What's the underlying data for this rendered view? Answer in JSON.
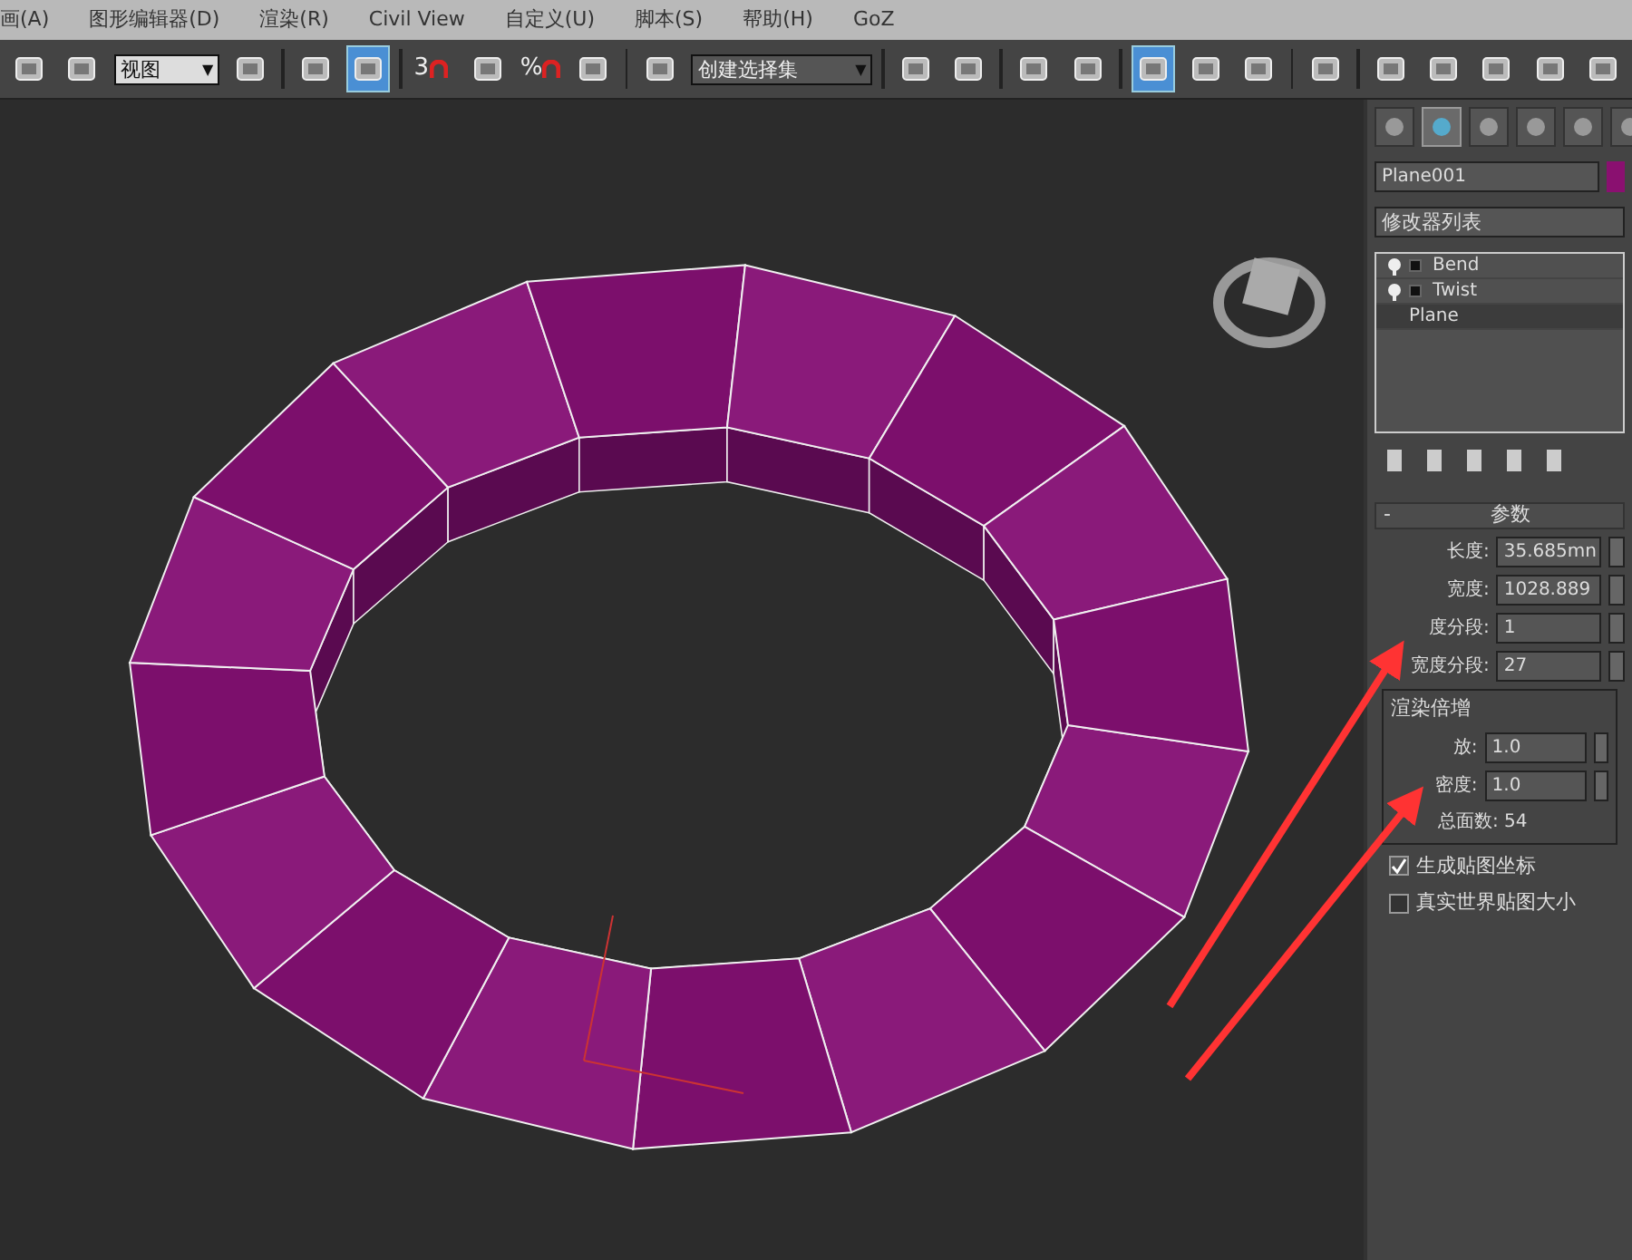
{
  "menu": [
    "画(A)",
    "图形编辑器(D)",
    "渲染(R)",
    "Civil View",
    "自定义(U)",
    "脚本(S)",
    "帮助(H)",
    "GoZ"
  ],
  "toolbar": [
    {
      "kind": "button",
      "selected": false
    },
    {
      "kind": "button",
      "selected": false
    },
    {
      "kind": "dropdown",
      "value": "视图",
      "caret": "▼"
    },
    {
      "kind": "button",
      "selected": false
    },
    {
      "kind": "sep"
    },
    {
      "kind": "button",
      "selected": false
    },
    {
      "kind": "button",
      "selected": true
    },
    {
      "kind": "sep"
    },
    {
      "kind": "snap",
      "glyph": "3",
      "selected": false
    },
    {
      "kind": "button",
      "selected": false
    },
    {
      "kind": "snap",
      "glyph": "%",
      "selected": false
    },
    {
      "kind": "button",
      "selected": false
    },
    {
      "kind": "sep"
    },
    {
      "kind": "button",
      "selected": false
    },
    {
      "kind": "dropdown",
      "value": "创建选择集",
      "caret": "▼"
    },
    {
      "kind": "sep"
    },
    {
      "kind": "button",
      "selected": false
    },
    {
      "kind": "button",
      "selected": false
    },
    {
      "kind": "sep"
    },
    {
      "kind": "button",
      "selected": false
    },
    {
      "kind": "button",
      "selected": false
    },
    {
      "kind": "sep"
    },
    {
      "kind": "button",
      "selected": true
    },
    {
      "kind": "button",
      "selected": false
    },
    {
      "kind": "button",
      "selected": false
    },
    {
      "kind": "sep"
    },
    {
      "kind": "button",
      "selected": false
    },
    {
      "kind": "sep"
    },
    {
      "kind": "button",
      "selected": false
    },
    {
      "kind": "button",
      "selected": false
    },
    {
      "kind": "button",
      "selected": false
    },
    {
      "kind": "button",
      "selected": false
    },
    {
      "kind": "button",
      "selected": false
    }
  ],
  "command_tabs": [
    {
      "selected": false
    },
    {
      "selected": true
    },
    {
      "selected": false
    },
    {
      "selected": false
    },
    {
      "selected": false
    },
    {
      "selected": false
    }
  ],
  "object_name": "Plane001",
  "modifier_list": "修改器列表",
  "stack": [
    {
      "label": "Bend",
      "modifier": true,
      "selected": false
    },
    {
      "label": "Twist",
      "modifier": true,
      "selected": false
    },
    {
      "label": "Plane",
      "modifier": false,
      "selected": true
    }
  ],
  "rollout": {
    "toggle": "-",
    "title": "参数",
    "fields": [
      {
        "label": "长度:",
        "value": "35.685mn"
      },
      {
        "label": "宽度:",
        "value": "1028.889"
      },
      {
        "label": "度分段:",
        "value": "1"
      },
      {
        "label": "宽度分段:",
        "value": "27"
      }
    ],
    "group": {
      "title": "渲染倍增",
      "fields": [
        {
          "label": "放:",
          "value": "1.0"
        },
        {
          "label": "密度:",
          "value": "1.0"
        }
      ],
      "total": "总面数: 54"
    },
    "checks": [
      {
        "label": "生成贴图坐标",
        "checked": true
      },
      {
        "label": "真实世界贴图大小",
        "checked": false
      }
    ]
  }
}
